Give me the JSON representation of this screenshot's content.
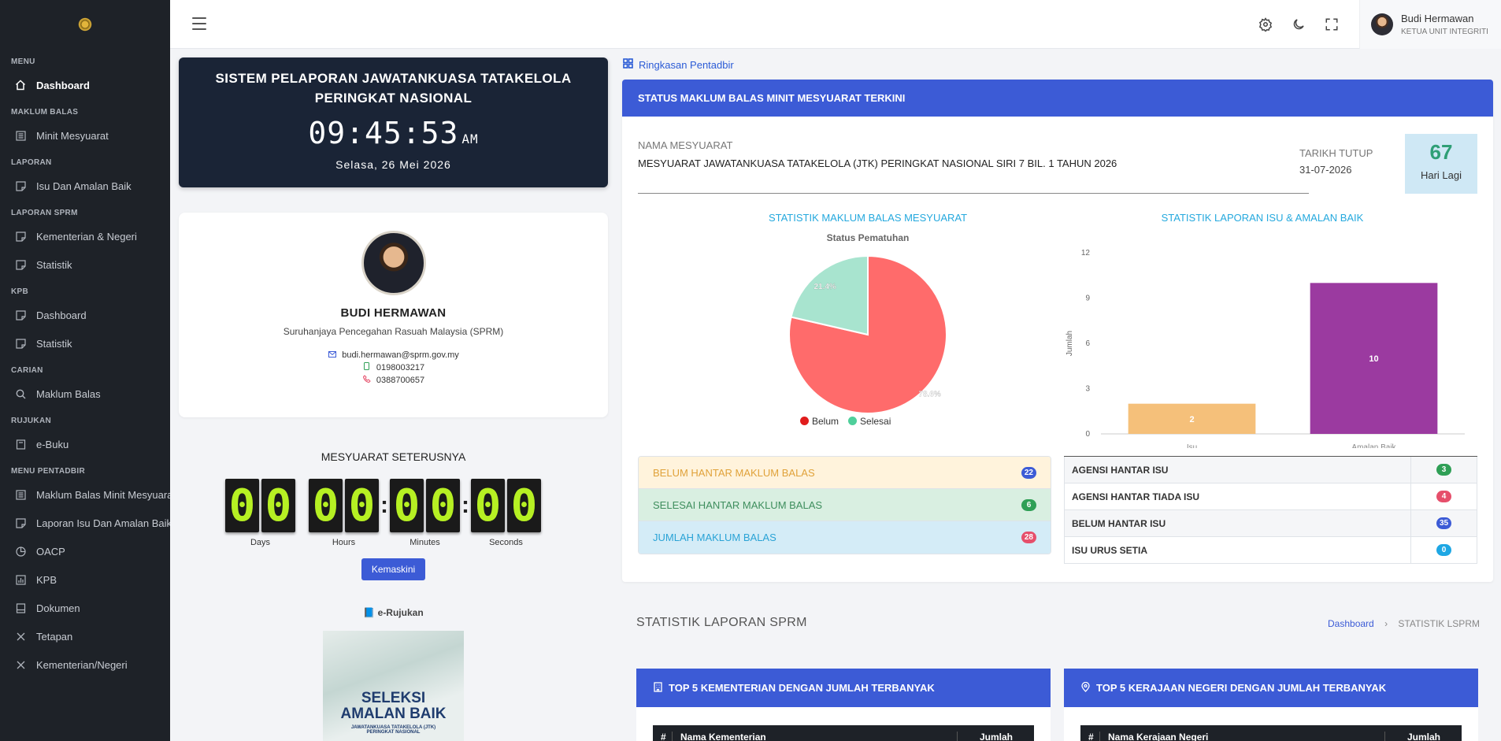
{
  "sidebar": {
    "sections": [
      {
        "title": "MENU",
        "items": [
          {
            "label": "Dashboard",
            "icon": "home-icon",
            "active": true
          }
        ]
      },
      {
        "title": "MAKLUM BALAS",
        "items": [
          {
            "label": "Minit Mesyuarat",
            "icon": "list-icon"
          }
        ]
      },
      {
        "title": "LAPORAN",
        "items": [
          {
            "label": "Isu Dan Amalan Baik",
            "icon": "note-icon"
          }
        ]
      },
      {
        "title": "LAPORAN SPRM",
        "items": [
          {
            "label": "Kementerian & Negeri",
            "icon": "note-icon"
          },
          {
            "label": "Statistik",
            "icon": "note-icon"
          }
        ]
      },
      {
        "title": "KPB",
        "items": [
          {
            "label": "Dashboard",
            "icon": "note-icon"
          },
          {
            "label": "Statistik",
            "icon": "note-icon"
          }
        ]
      },
      {
        "title": "CARIAN",
        "items": [
          {
            "label": "Maklum Balas",
            "icon": "search-icon"
          }
        ]
      },
      {
        "title": "RUJUKAN",
        "items": [
          {
            "label": "e-Buku",
            "icon": "book-icon"
          }
        ]
      },
      {
        "title": "MENU PENTADBIR",
        "items": [
          {
            "label": "Maklum Balas Minit Mesyuarat",
            "icon": "list-icon"
          },
          {
            "label": "Laporan Isu Dan Amalan Baik",
            "icon": "note-icon"
          },
          {
            "label": "OACP",
            "icon": "pie-icon"
          },
          {
            "label": "KPB",
            "icon": "chart-icon"
          },
          {
            "label": "Dokumen",
            "icon": "archive-icon"
          },
          {
            "label": "Tetapan",
            "icon": "tools-icon"
          },
          {
            "label": "Kementerian/Negeri",
            "icon": "tools-icon"
          }
        ]
      }
    ]
  },
  "topbar": {
    "user_name": "Budi Hermawan",
    "user_role": "KETUA UNIT INTEGRITI"
  },
  "clock": {
    "title": "SISTEM PELAPORAN JAWATANKUASA TATAKELOLA PERINGKAT NASIONAL",
    "time": "09:45:53",
    "ampm": "AM",
    "date": "Selasa, 26 Mei 2026"
  },
  "profile": {
    "name": "BUDI HERMAWAN",
    "org": "Suruhanjaya Pencegahan Rasuah Malaysia (SPRM)",
    "email": "budi.hermawan@sprm.gov.my",
    "mobile": "0198003217",
    "phone": "0388700657"
  },
  "next_meeting": {
    "title": "MESYUARAT SETERUSNYA",
    "days": "00",
    "hours": "00",
    "minutes": "00",
    "seconds": "00",
    "days_label": "Days",
    "hours_label": "Hours",
    "minutes_label": "Minutes",
    "seconds_label": "Seconds",
    "button": "Kemaskini"
  },
  "erujukan": {
    "title": "e-Rujukan",
    "book_title_1": "SELEKSI",
    "book_title_2": "AMALAN BAIK",
    "book_sub_1": "JAWATANKUASA TATAKELOLA (JTK)",
    "book_sub_2": "PERINGKAT NASIONAL"
  },
  "ringkasan": "Ringkasan Pentadbir",
  "status": {
    "header": "STATUS MAKLUM BALAS MINIT MESYUARAT TERKINI",
    "nama_label": "NAMA MESYUARAT",
    "nama_value": "MESYUARAT JAWATANKUASA TATAKELOLA (JTK) PERINGKAT NASIONAL SIRI 7 BIL. 1 TAHUN 2026",
    "tarikh_label": "TARIKH TUTUP",
    "tarikh_value": "31-07-2026",
    "hari_num": "67",
    "hari_label": "Hari Lagi",
    "pie_title": "STATISTIK MAKLUM BALAS MESYUARAT",
    "bar_title": "STATISTIK LAPORAN ISU & AMALAN BAIK",
    "list": [
      {
        "label": "BELUM HANTAR MAKLUM BALAS",
        "value": "22",
        "bg": "#fff3dc",
        "fg": "#e0a23a",
        "badge": "#3c5bd6"
      },
      {
        "label": "SELESAI HANTAR MAKLUM BALAS",
        "value": "6",
        "bg": "#d9efe1",
        "fg": "#3e8e5d",
        "badge": "#2f9f56"
      },
      {
        "label": "JUMLAH MAKLUM BALAS",
        "value": "28",
        "bg": "#d4ecf7",
        "fg": "#2aa3d6",
        "badge": "#e64f6b"
      }
    ],
    "isu": [
      {
        "label": "AGENSI HANTAR ISU",
        "value": "3",
        "badge": "#2f9f56"
      },
      {
        "label": "AGENSI HANTAR TIADA ISU",
        "value": "4",
        "badge": "#e64f6b"
      },
      {
        "label": "BELUM HANTAR ISU",
        "value": "35",
        "badge": "#3c5bd6"
      },
      {
        "label": "ISU URUS SETIA",
        "value": "0",
        "badge": "#1ea7e4"
      }
    ]
  },
  "chart_data": [
    {
      "type": "pie",
      "subtitle": "Status Pematuhan",
      "labels": [
        "Belum",
        "Selesai"
      ],
      "values": [
        78.6,
        21.4
      ],
      "value_labels": [
        "78.6%",
        "21.4%"
      ],
      "colors": [
        "#ff6b6b",
        "#a8e4cf"
      ],
      "legend_marker_colors": [
        "#e01c1c",
        "#4fcf9b"
      ],
      "legend_position": "bottom"
    },
    {
      "type": "bar",
      "categories": [
        "Isu",
        "Amalan Baik"
      ],
      "values": [
        2,
        10
      ],
      "colors": [
        "#f5c07a",
        "#9b3aa0"
      ],
      "ylabel": "Jumlah",
      "ylim": [
        0,
        12
      ],
      "yticks": [
        0,
        3,
        6,
        9,
        12
      ]
    }
  ],
  "lsprm": {
    "title": "STATISTIK LAPORAN SPRM",
    "crumb_home": "Dashboard",
    "crumb_sep": "›",
    "crumb_current": "STATISTIK LSPRM",
    "kementerian_header": "TOP 5 KEMENTERIAN DENGAN JUMLAH TERBANYAK",
    "kementerian_cols": [
      "#",
      "Nama Kementerian",
      "Jumlah"
    ],
    "negeri_header": "TOP 5 KERAJAAN NEGERI DENGAN JUMLAH TERBANYAK",
    "negeri_cols": [
      "#",
      "Nama Kerajaan Negeri",
      "Jumlah"
    ]
  }
}
